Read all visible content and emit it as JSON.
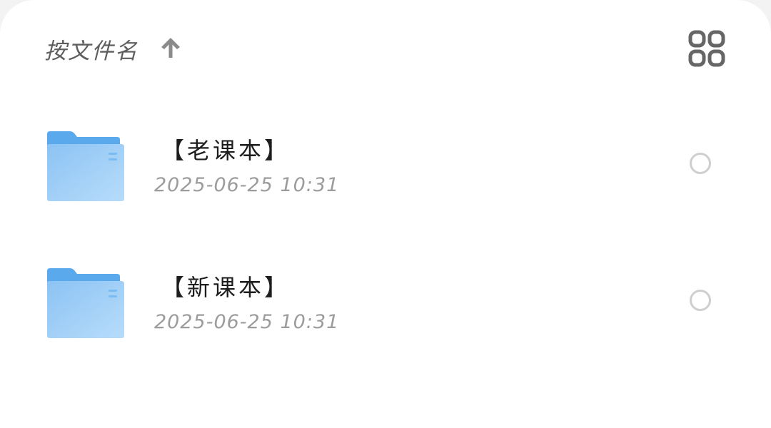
{
  "header": {
    "sort_label": "按文件名",
    "sort_arrow_icon": "arrow-up-icon",
    "view_toggle_icon": "grid-view-icon"
  },
  "files": [
    {
      "name": "【老课本】",
      "date": "2025-06-25 10:31",
      "icon": "folder-icon",
      "selected": false
    },
    {
      "name": "【新课本】",
      "date": "2025-06-25 10:31",
      "icon": "folder-icon",
      "selected": false
    }
  ],
  "colors": {
    "folder_back": "#5aa9ec",
    "folder_front": "#a9d4f8",
    "radio_border": "#cfcfcf",
    "header_text": "#5e5e5e",
    "date_text": "#9c9c9c"
  }
}
